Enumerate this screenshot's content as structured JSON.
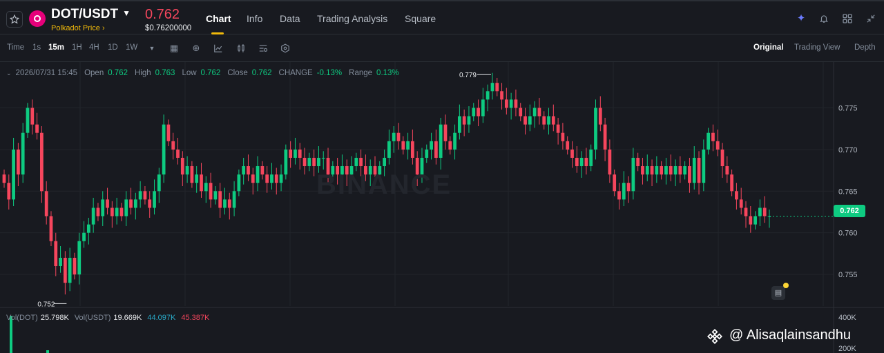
{
  "header": {
    "pair": "DOT/USDT",
    "subtitle": "Polkadot Price",
    "subtitle_arrow": "›",
    "last_price": "0.762",
    "usd_price": "$0.76200000",
    "tabs": [
      "Chart",
      "Info",
      "Data",
      "Trading Analysis",
      "Square"
    ],
    "active_tab": "Chart",
    "icons": [
      "sparkle-icon",
      "bell-icon",
      "grid-layout-icon",
      "collapse-icon"
    ]
  },
  "toolbar": {
    "intervals": [
      "Time",
      "1s",
      "15m",
      "1H",
      "4H",
      "1D",
      "1W"
    ],
    "active_interval": "15m",
    "views": [
      "Original",
      "Trading View",
      "Depth"
    ],
    "active_view": "Original"
  },
  "ohlc": {
    "timestamp": "2026/07/31 15:45",
    "open_label": "Open",
    "open": "0.762",
    "high_label": "High",
    "high": "0.763",
    "low_label": "Low",
    "low": "0.762",
    "close_label": "Close",
    "close": "0.762",
    "change_label": "CHANGE",
    "change": "-0.13%",
    "range_label": "Range",
    "range": "0.13%"
  },
  "chart_data": {
    "type": "candlestick",
    "y_ticks": [
      "0.775",
      "0.770",
      "0.765",
      "0.760",
      "0.755"
    ],
    "ylim": [
      0.7512,
      0.7805
    ],
    "high_marker": "0.779",
    "low_marker": "0.752",
    "last_price": "0.762",
    "watermark": "BINANCE",
    "colors": {
      "up": "#0ecb81",
      "down": "#f6465d",
      "grid": "#22252b"
    },
    "closes": [
      0.766,
      0.764,
      0.77,
      0.767,
      0.772,
      0.775,
      0.773,
      0.772,
      0.765,
      0.762,
      0.759,
      0.756,
      0.757,
      0.754,
      0.757,
      0.755,
      0.759,
      0.76,
      0.761,
      0.763,
      0.762,
      0.764,
      0.763,
      0.762,
      0.763,
      0.762,
      0.764,
      0.763,
      0.764,
      0.765,
      0.764,
      0.763,
      0.765,
      0.767,
      0.773,
      0.771,
      0.77,
      0.769,
      0.767,
      0.768,
      0.766,
      0.767,
      0.765,
      0.766,
      0.764,
      0.765,
      0.763,
      0.764,
      0.763,
      0.765,
      0.767,
      0.768,
      0.767,
      0.766,
      0.768,
      0.767,
      0.766,
      0.767,
      0.766,
      0.767,
      0.77,
      0.769,
      0.77,
      0.769,
      0.768,
      0.769,
      0.768,
      0.769,
      0.769,
      0.767,
      0.768,
      0.767,
      0.768,
      0.767,
      0.768,
      0.769,
      0.768,
      0.767,
      0.768,
      0.767,
      0.768,
      0.769,
      0.771,
      0.772,
      0.771,
      0.77,
      0.771,
      0.769,
      0.767,
      0.769,
      0.77,
      0.771,
      0.769,
      0.773,
      0.771,
      0.77,
      0.772,
      0.774,
      0.773,
      0.774,
      0.775,
      0.774,
      0.776,
      0.777,
      0.778,
      0.777,
      0.776,
      0.775,
      0.776,
      0.775,
      0.774,
      0.773,
      0.774,
      0.775,
      0.774,
      0.773,
      0.774,
      0.773,
      0.772,
      0.771,
      0.77,
      0.769,
      0.768,
      0.769,
      0.768,
      0.77,
      0.775,
      0.773,
      0.77,
      0.767,
      0.765,
      0.764,
      0.766,
      0.765,
      0.769,
      0.768,
      0.767,
      0.768,
      0.767,
      0.768,
      0.767,
      0.768,
      0.767,
      0.768,
      0.767,
      0.768,
      0.766,
      0.769,
      0.766,
      0.77,
      0.772,
      0.771,
      0.77,
      0.768,
      0.767,
      0.765,
      0.764,
      0.763,
      0.762,
      0.761,
      0.762,
      0.763,
      0.762,
      0.762
    ]
  },
  "volume": {
    "vol_dot_label": "Vol(DOT)",
    "vol_dot": "25.798K",
    "vol_usdt_label": "Vol(USDT)",
    "vol_usdt": "19.669K",
    "ma1": "44.097K",
    "ma2": "45.387K",
    "ticks": [
      "400K",
      "200K"
    ]
  },
  "watermark_handle": "@ Alisaqlainsandhu"
}
